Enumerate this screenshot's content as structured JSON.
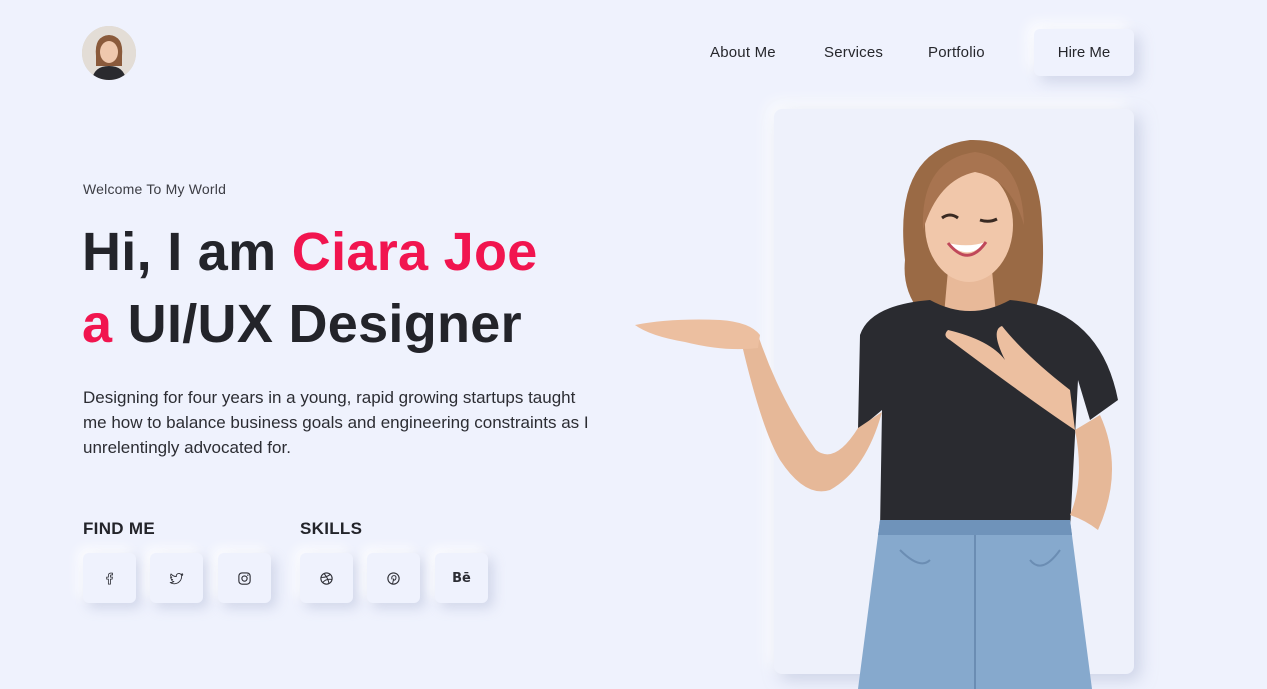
{
  "nav": {
    "items": [
      {
        "label": "About Me"
      },
      {
        "label": "Services"
      },
      {
        "label": "Portfolio"
      }
    ],
    "hire_label": "Hire Me"
  },
  "hero": {
    "welcome": "Welcome To My World",
    "greeting": "Hi, I am ",
    "name": "Ciara Joe",
    "article": "a",
    "role": " UI/UX Designer",
    "intro": "Designing for four years in a young, rapid growing startups taught me how to balance business goals and engineering constraints as I unrelentingly advocated for."
  },
  "find_me": {
    "title": "FIND ME",
    "icons": [
      "facebook-icon",
      "twitter-icon",
      "instagram-icon"
    ]
  },
  "skills": {
    "title": "SKILLS",
    "icons": [
      "dribbble-icon",
      "pinterest-icon",
      "behance-icon"
    ],
    "behance_label": "Bē"
  },
  "colors": {
    "background": "#eff2fd",
    "accent": "#f1154f",
    "text": "#23242a"
  }
}
